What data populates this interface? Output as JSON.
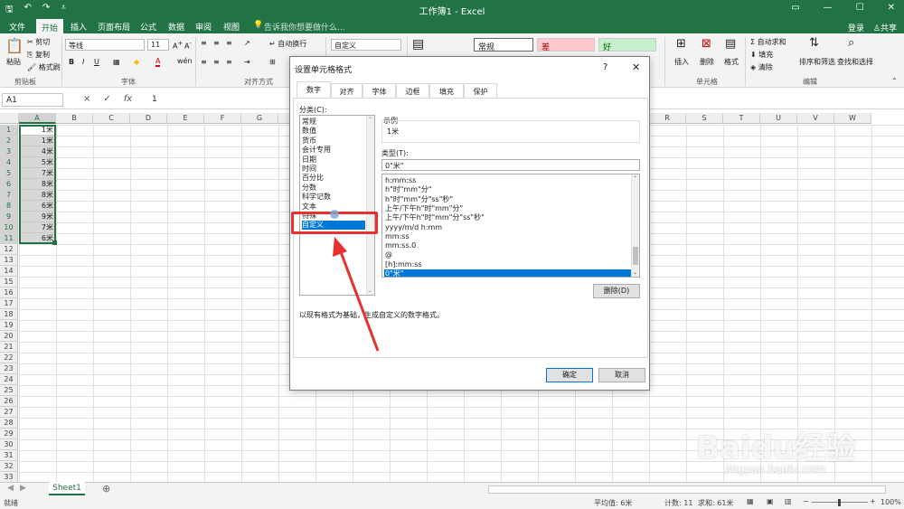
{
  "titlebar": {
    "title": "工作簿1 - Excel"
  },
  "tabs": [
    "文件",
    "开始",
    "插入",
    "页面布局",
    "公式",
    "数据",
    "审阅",
    "视图"
  ],
  "tell_me": "告诉我你想要做什么...",
  "account": {
    "login": "登录",
    "share": "共享"
  },
  "ribbon": {
    "clipboard": {
      "paste": "粘贴",
      "cut": "剪切",
      "copy": "复制",
      "format_painter": "格式刷",
      "label": "剪贴板"
    },
    "font": {
      "name": "等线",
      "size": "11",
      "label": "字体",
      "bold": "B",
      "italic": "I",
      "underline": "U"
    },
    "alignment": {
      "wrap": "自动换行",
      "label": "对齐方式"
    },
    "number": {
      "format": "自定义"
    },
    "styles": {
      "normal": "常规",
      "bad": "差",
      "good": "好"
    },
    "cells": {
      "insert": "插入",
      "delete": "删除",
      "format": "格式",
      "label": "单元格"
    },
    "editing": {
      "autosum": "自动求和",
      "fill": "填充",
      "clear": "清除",
      "sort": "排序和筛选",
      "find": "查找和选择",
      "label": "编辑"
    }
  },
  "formula_bar": {
    "name_box": "A1",
    "cancel": "×",
    "enter": "✓",
    "fx": "fx",
    "value": "1"
  },
  "columns": [
    "A",
    "B",
    "C",
    "D",
    "E",
    "F",
    "G",
    "H",
    "I",
    "J",
    "K",
    "L",
    "M",
    "N",
    "O",
    "P",
    "Q",
    "R",
    "S",
    "T",
    "U",
    "V",
    "W"
  ],
  "rows": [
    "1",
    "2",
    "3",
    "4",
    "5",
    "6",
    "7",
    "8",
    "9",
    "10",
    "11",
    "12",
    "13",
    "14",
    "15",
    "16",
    "17",
    "18",
    "19",
    "20",
    "21",
    "22",
    "23",
    "24",
    "25",
    "26",
    "27",
    "28",
    "29",
    "30",
    "31",
    "32",
    "33"
  ],
  "column_a_values": [
    "1米",
    "1米",
    "4米",
    "5米",
    "7米",
    "8米",
    "8米",
    "6米",
    "9米",
    "7米",
    "6米"
  ],
  "sheet_tabs": [
    "Sheet1"
  ],
  "status": {
    "mode": "就绪",
    "average": "平均值: 6米",
    "count": "计数: 11",
    "sum": "求和: 61米",
    "zoom": "100%"
  },
  "dialog": {
    "title": "设置单元格格式",
    "help": "?",
    "close": "✕",
    "tabs": [
      "数字",
      "对齐",
      "字体",
      "边框",
      "填充",
      "保护"
    ],
    "category_label": "分类(C):",
    "categories": [
      "常规",
      "数值",
      "货币",
      "会计专用",
      "日期",
      "时间",
      "百分比",
      "分数",
      "科学记数",
      "文本",
      "特殊",
      "自定义"
    ],
    "sample_label": "示例",
    "sample_value": "1米",
    "type_label": "类型(T):",
    "type_value": "0\"米\"",
    "formats": [
      "h:mm:ss",
      "h\"时\"mm\"分\"",
      "h\"时\"mm\"分\"ss\"秒\"",
      "上午/下午h\"时\"mm\"分\"",
      "上午/下午h\"时\"mm\"分\"ss\"秒\"",
      "yyyy/m/d h:mm",
      "mm:ss",
      "mm:ss.0",
      "@",
      "[h]:mm:ss",
      "0\"米\""
    ],
    "delete_button": "删除(D)",
    "description": "以现有格式为基础，生成自定义的数字格式。",
    "ok": "确定",
    "cancel": "取消"
  },
  "watermark": {
    "logo": "Baidu经验",
    "url": "jingyan.baidu.com"
  }
}
